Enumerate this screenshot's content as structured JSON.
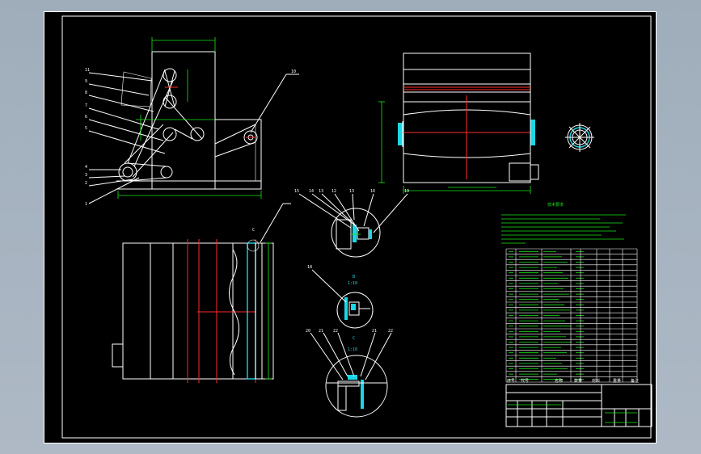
{
  "colors": {
    "sheet": "#000000",
    "line": "#ffffff",
    "dim": "#19e619",
    "center": "#ff2a2a",
    "part": "#19d7e6",
    "background": "#a6b2bf"
  },
  "side_view": {
    "balloons": [
      "11",
      "9",
      "8",
      "7",
      "6",
      "5",
      "4",
      "3",
      "2",
      "1"
    ],
    "balloon_right": "10"
  },
  "detail_a": {
    "labels": [
      "15",
      "14",
      "13",
      "12",
      "13",
      "16",
      "19"
    ]
  },
  "detail_b": {
    "mark": "B",
    "scale": "1:10",
    "label": "18"
  },
  "detail_c": {
    "mark": "C",
    "scale": "1:10",
    "labels": [
      "20",
      "21",
      "22",
      "21",
      "22"
    ]
  },
  "bottom_view": {
    "mark": "C"
  },
  "tech_requirements": {
    "title": "技术要求"
  },
  "title_block": {
    "col_seq": "序号",
    "col_code": "代号",
    "col_name": "名称",
    "col_qty": "数量",
    "col_mat": "材料",
    "col_wt": "重量",
    "col_note": "备注"
  }
}
